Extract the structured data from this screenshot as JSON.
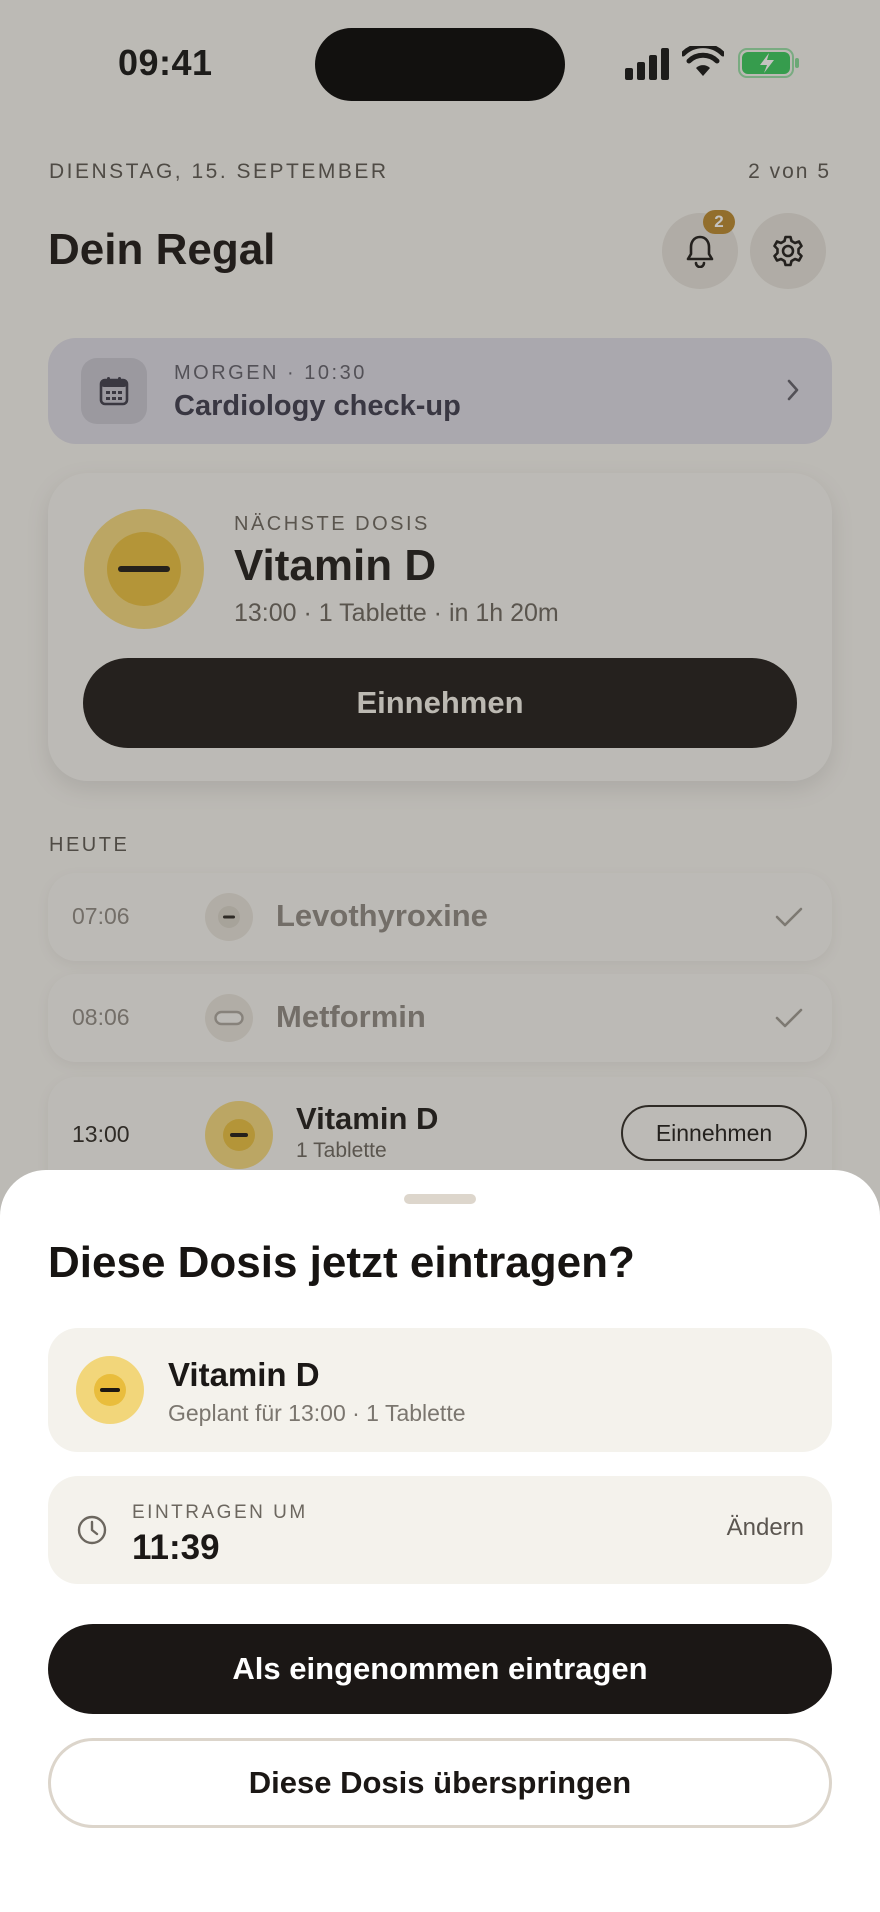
{
  "status_bar": {
    "time": "09:41"
  },
  "header": {
    "date": "DIENSTAG, 15. SEPTEMBER",
    "progress": "2 von 5",
    "title": "Dein Regal",
    "notification_count": "2"
  },
  "appointment": {
    "meta": "MORGEN · 10:30",
    "title": "Cardiology check-up"
  },
  "next_dose": {
    "eyebrow": "NÄCHSTE DOSIS",
    "name": "Vitamin D",
    "details": "13:00 · 1 Tablette · in 1h 20m",
    "action_label": "Einnehmen"
  },
  "today": {
    "label": "HEUTE",
    "items": [
      {
        "time": "07:06",
        "name": "Levothyroxine",
        "status": "taken"
      },
      {
        "time": "08:06",
        "name": "Metformin",
        "status": "taken"
      },
      {
        "time": "13:00",
        "name": "Vitamin D",
        "dose": "1 Tablette",
        "action_label": "Einnehmen"
      }
    ]
  },
  "sheet": {
    "title": "Diese Dosis jetzt eintragen?",
    "med_name": "Vitamin D",
    "med_sub": "Geplant für 13:00 · 1 Tablette",
    "time_label": "EINTRAGEN UM",
    "time_value": "11:39",
    "change_label": "Ändern",
    "confirm_label": "Als eingenommen eintragen",
    "skip_label": "Diese Dosis überspringen"
  },
  "colors": {
    "accent_yellow": "#f2d67a",
    "dark": "#1b1715",
    "badge": "#b8862a",
    "battery_green": "#34c759"
  }
}
